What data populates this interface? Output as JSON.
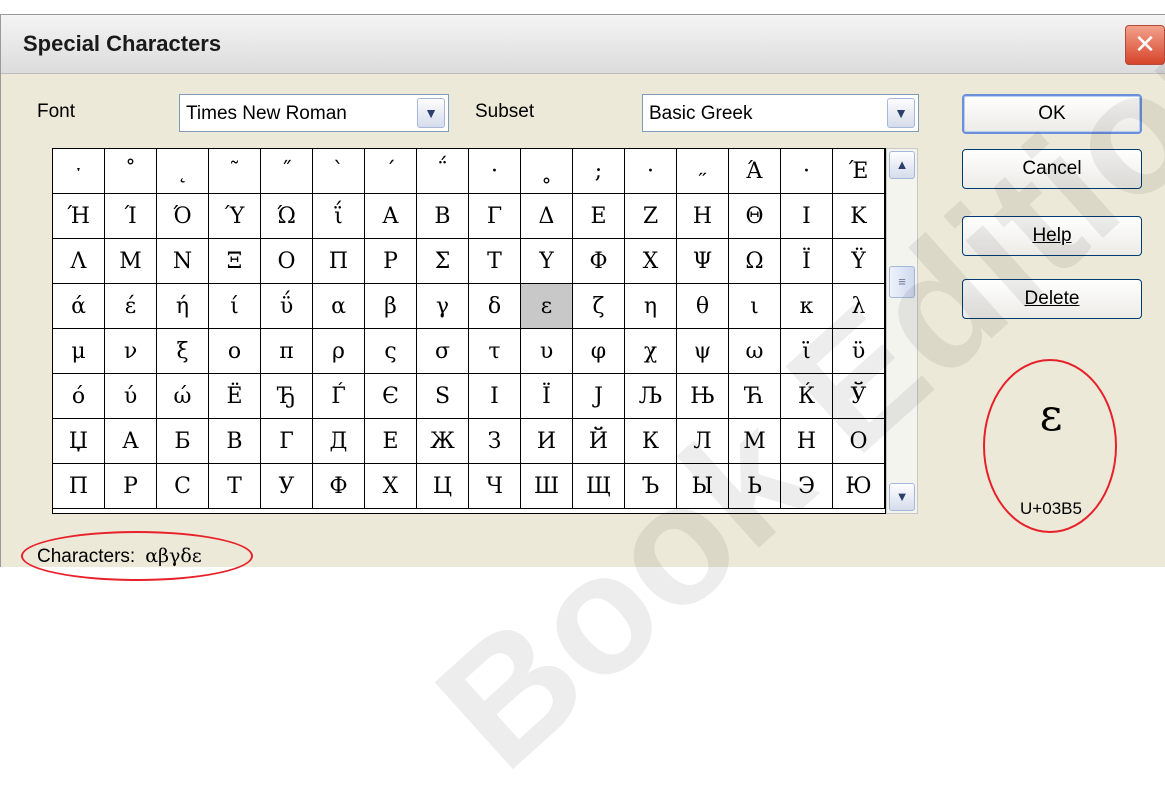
{
  "dialog": {
    "title": "Special Characters",
    "close_glyph": "✕"
  },
  "font": {
    "label": "Font",
    "value": "Times New Roman"
  },
  "subset": {
    "label": "Subset",
    "value": "Basic Greek"
  },
  "grid": {
    "rows": [
      [
        "ˑ",
        "˚",
        "˛",
        "˜",
        "˝",
        "ˋ",
        "΄",
        "΅",
        "·",
        "˳",
        ";",
        "·",
        "˶",
        "Ά",
        "·",
        "Έ"
      ],
      [
        "Ή",
        "Ί",
        "Ό",
        "Ύ",
        "Ώ",
        "ΐ",
        "Α",
        "Β",
        "Γ",
        "Δ",
        "Ε",
        "Ζ",
        "Η",
        "Θ",
        "Ι",
        "Κ"
      ],
      [
        "Λ",
        "Μ",
        "Ν",
        "Ξ",
        "Ο",
        "Π",
        "Ρ",
        "Σ",
        "Τ",
        "Υ",
        "Φ",
        "Χ",
        "Ψ",
        "Ω",
        "Ϊ",
        "Ϋ"
      ],
      [
        "ά",
        "έ",
        "ή",
        "ί",
        "ΰ",
        "α",
        "β",
        "γ",
        "δ",
        "ε",
        "ζ",
        "η",
        "θ",
        "ι",
        "κ",
        "λ"
      ],
      [
        "μ",
        "ν",
        "ξ",
        "ο",
        "π",
        "ρ",
        "ς",
        "σ",
        "τ",
        "υ",
        "φ",
        "χ",
        "ψ",
        "ω",
        "ϊ",
        "ϋ"
      ],
      [
        "ό",
        "ύ",
        "ώ",
        "Ё",
        "Ђ",
        "Ѓ",
        "Є",
        "Ѕ",
        "І",
        "Ї",
        "Ј",
        "Љ",
        "Њ",
        "Ћ",
        "Ќ",
        "Ў"
      ],
      [
        "Џ",
        "А",
        "Б",
        "В",
        "Г",
        "Д",
        "Е",
        "Ж",
        "З",
        "И",
        "Й",
        "К",
        "Л",
        "М",
        "Н",
        "О"
      ],
      [
        "П",
        "Р",
        "С",
        "Т",
        "У",
        "Ф",
        "Х",
        "Ц",
        "Ч",
        "Ш",
        "Щ",
        "Ъ",
        "Ы",
        "Ь",
        "Э",
        "Ю"
      ]
    ],
    "selected": {
      "row": 3,
      "col": 9
    }
  },
  "buttons": {
    "ok": "OK",
    "cancel": "Cancel",
    "help": "Help",
    "delete": "Delete"
  },
  "preview": {
    "char": "ε",
    "code": "U+03B5"
  },
  "characters": {
    "label": "Characters:",
    "value": "αβγδε"
  },
  "scrollbar": {
    "up": "▲",
    "down": "▼",
    "thumb": "≡"
  },
  "annotation_color": "#e8202a"
}
